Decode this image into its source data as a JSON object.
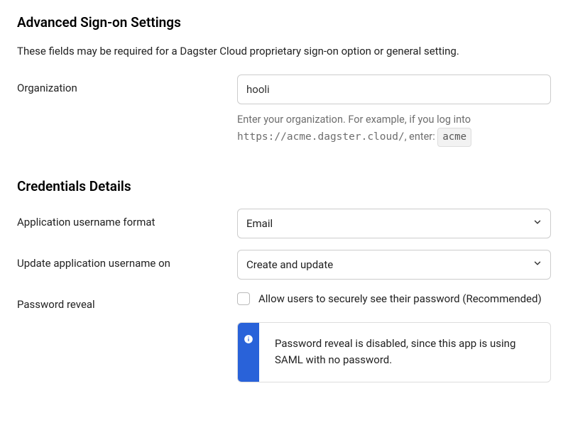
{
  "section1": {
    "title": "Advanced Sign-on Settings",
    "description": "These fields may be required for a Dagster Cloud proprietary sign-on option or general setting.",
    "org": {
      "label": "Organization",
      "value": "hooli",
      "helper_prefix": "Enter your organization. For example, if you log into ",
      "helper_url": "https://acme.dagster.cloud/",
      "helper_mid": ", enter: ",
      "helper_chip": "acme"
    }
  },
  "section2": {
    "title": "Credentials Details",
    "username_format": {
      "label": "Application username format",
      "value": "Email"
    },
    "update_on": {
      "label": "Update application username on",
      "value": "Create and update"
    },
    "password_reveal": {
      "label": "Password reveal",
      "checkbox_label": "Allow users to securely see their password (Recommended)",
      "info_text": "Password reveal is disabled, since this app is using SAML with no password."
    }
  }
}
